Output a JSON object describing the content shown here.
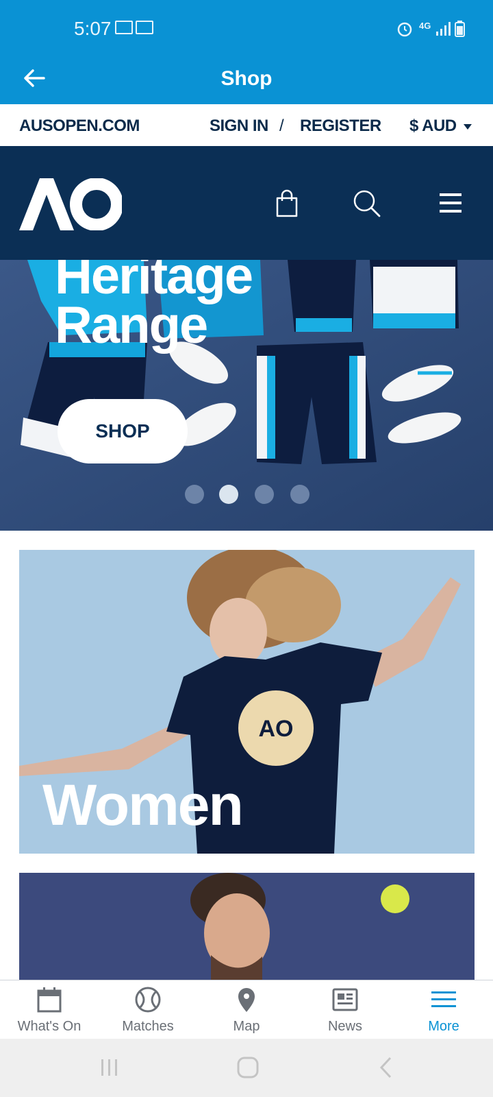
{
  "status_bar": {
    "time": "5:07",
    "network": "4G"
  },
  "header": {
    "title": "Shop"
  },
  "site_bar": {
    "home_link": "AUSOPEN.COM",
    "sign_in": "SIGN IN",
    "separator": "/",
    "register": "REGISTER",
    "currency": "$ AUD"
  },
  "nav": {
    "logo": "AO"
  },
  "hero": {
    "title_line1": "Heritage",
    "title_line2": "Range",
    "button_label": "SHOP",
    "dots": 4,
    "active_dot": 2
  },
  "cards": [
    {
      "label": "Women"
    },
    {
      "label": ""
    }
  ],
  "bottom_nav": {
    "items": [
      {
        "label": "What's On",
        "icon": "calendar-icon"
      },
      {
        "label": "Matches",
        "icon": "tennis-ball-icon"
      },
      {
        "label": "Map",
        "icon": "map-pin-icon"
      },
      {
        "label": "News",
        "icon": "news-icon"
      },
      {
        "label": "More",
        "icon": "menu-icon",
        "active": true
      }
    ]
  },
  "colors": {
    "primary": "#0a92d4",
    "navy": "#0b2f55",
    "text_dark": "#0b2a4a"
  }
}
